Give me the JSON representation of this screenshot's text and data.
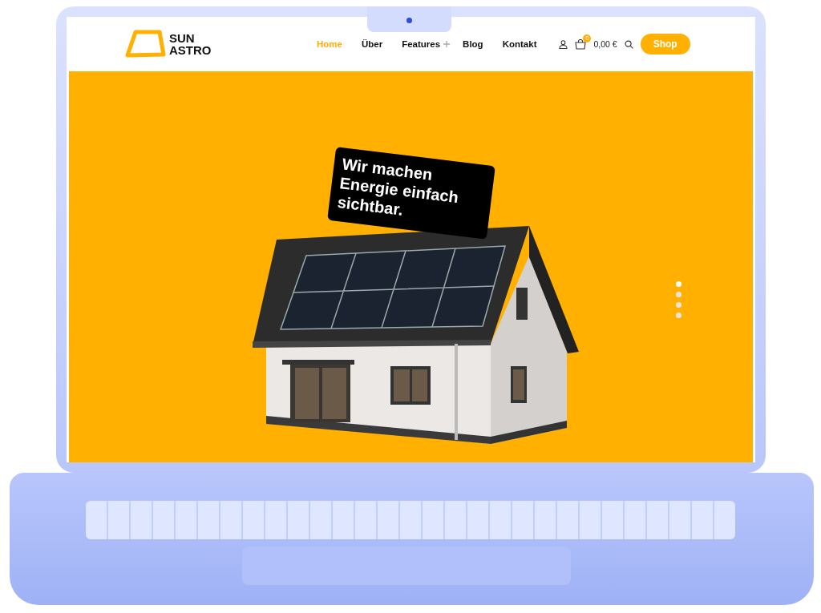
{
  "header": {
    "logo_lines": [
      "SUN",
      "ASTRO"
    ],
    "nav": [
      {
        "label": "Home",
        "selected": true,
        "has_submenu": false
      },
      {
        "label": "Über",
        "selected": false,
        "has_submenu": false
      },
      {
        "label": "Features",
        "selected": false,
        "has_submenu": true
      },
      {
        "label": "Blog",
        "selected": false,
        "has_submenu": false
      },
      {
        "label": "Kontakt",
        "selected": false,
        "has_submenu": false
      }
    ],
    "cart_count": "0",
    "cart_total": "0,00 €",
    "shop_button": "Shop"
  },
  "hero": {
    "headline": "Wir machen Energie einfach sichtbar.",
    "slides": [
      {
        "selected": true
      },
      {
        "selected": false
      },
      {
        "selected": false
      },
      {
        "selected": false
      }
    ]
  }
}
